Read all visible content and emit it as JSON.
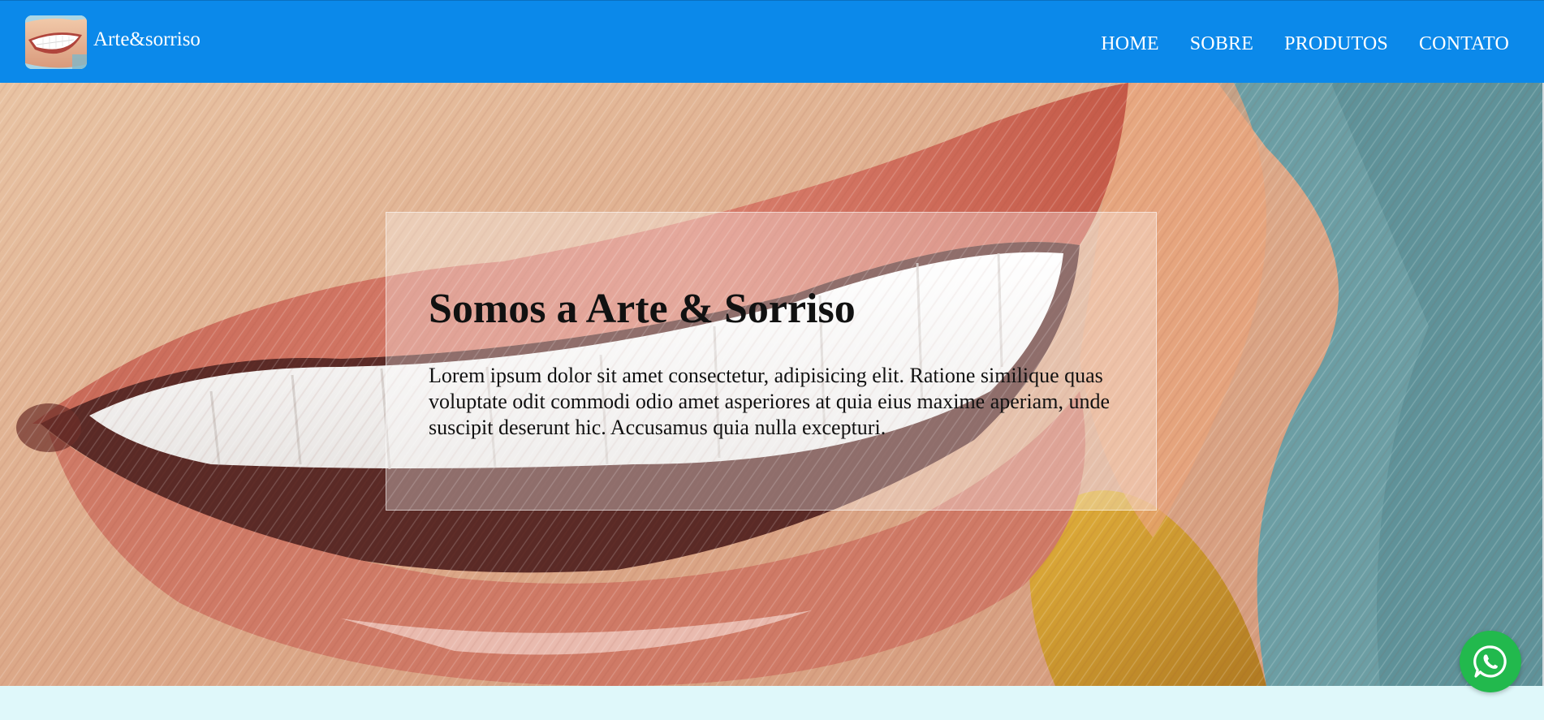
{
  "header": {
    "brand_name": "Arte&sorriso",
    "logo_icon": "smile-logo-icon",
    "background_color": "#0b89ea",
    "nav": [
      {
        "label": "HOME"
      },
      {
        "label": "SOBRE"
      },
      {
        "label": "PRODUTOS"
      },
      {
        "label": "CONTATO"
      }
    ]
  },
  "hero": {
    "background_image": "painted-smile-illustration",
    "title": "Somos a Arte & Sorriso",
    "text": "Lorem ipsum dolor sit amet consectetur, adipisicing elit. Ratione similique quas voluptate odit commodi odio amet asperiores at quia eius maxime aperiam, unde suscipit deserunt hic. Accusamus quia nulla excepturi."
  },
  "floating": {
    "whatsapp_icon": "whatsapp-icon",
    "whatsapp_color": "#22b94d"
  },
  "colors": {
    "section_below": "#dff8fa"
  }
}
